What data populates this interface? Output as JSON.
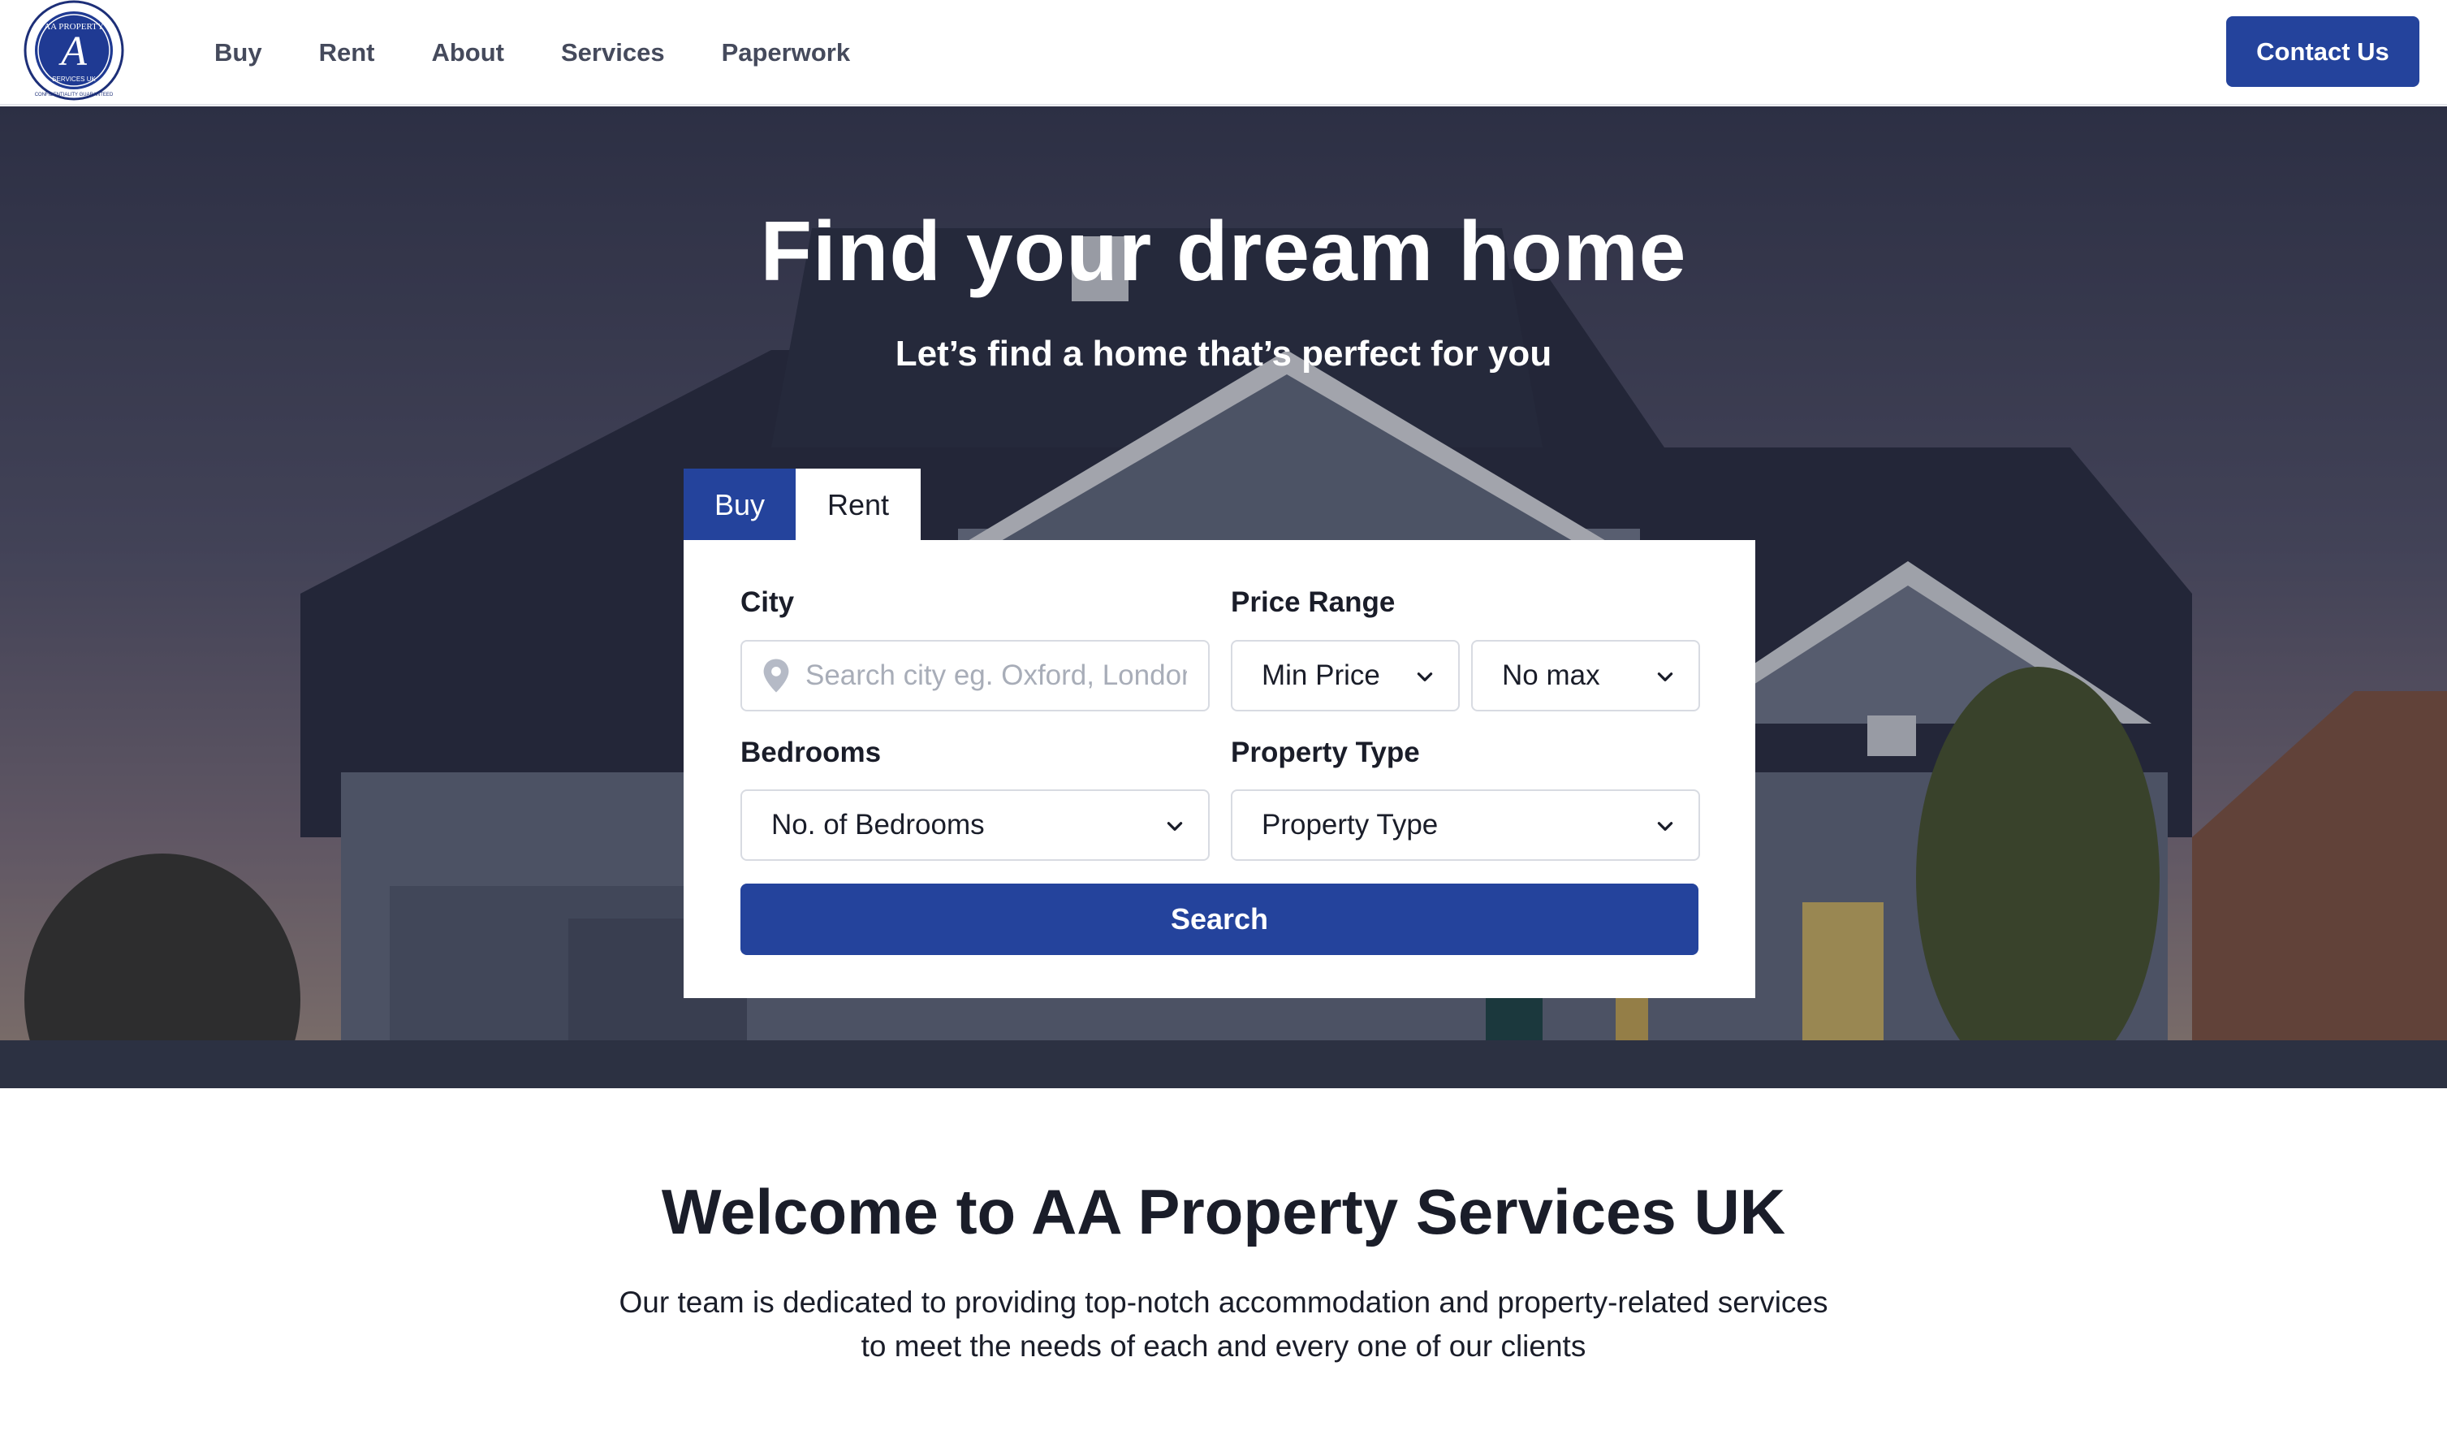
{
  "brand": {
    "logo_text_top": "AA PROPERTY",
    "logo_text_mid": "SERVICES UK",
    "logo_text_ring": "Our motto: CONFIDENTIALITY GUARANTEED",
    "logo_monogram": "A",
    "accent_color": "#24439c"
  },
  "nav": {
    "links": [
      "Buy",
      "Rent",
      "About",
      "Services",
      "Paperwork"
    ],
    "contact_label": "Contact Us"
  },
  "hero": {
    "title": "Find your dream home",
    "subtitle": "Let’s find a home that’s perfect for you"
  },
  "search": {
    "tabs": [
      "Buy",
      "Rent"
    ],
    "active_tab": "Buy",
    "city_label": "City",
    "city_placeholder": "Search city eg. Oxford, London",
    "price_label": "Price Range",
    "min_price": "Min Price",
    "max_price": "No max",
    "bedrooms_label": "Bedrooms",
    "bedrooms_value": "No. of Bedrooms",
    "type_label": "Property Type",
    "type_value": "Property Type",
    "button": "Search"
  },
  "welcome": {
    "title": "Welcome to AA Property Services UK",
    "text": "Our team is dedicated to providing top-notch accommodation and property-related services to meet the needs of each and every one of our clients"
  }
}
